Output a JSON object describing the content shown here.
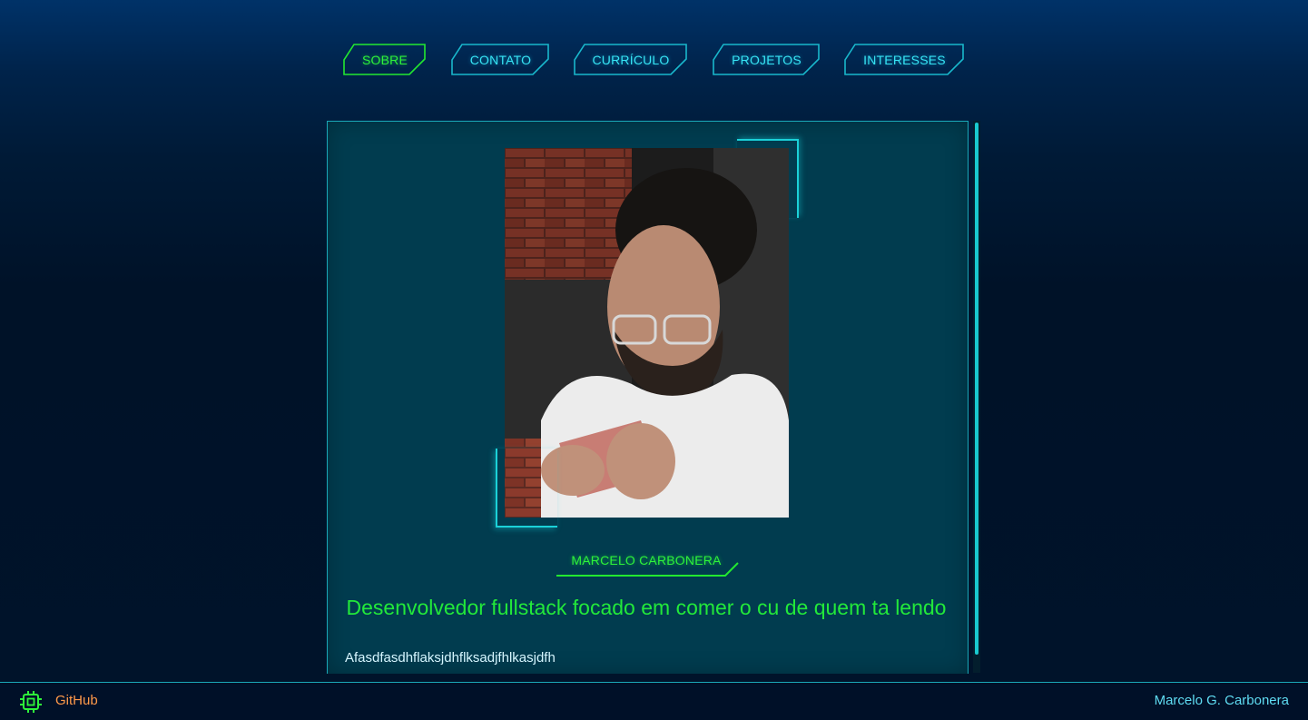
{
  "nav": {
    "tabs": [
      {
        "label": "SOBRE",
        "active": true
      },
      {
        "label": "CONTATO",
        "active": false
      },
      {
        "label": "CURRÍCULO",
        "active": false
      },
      {
        "label": "PROJETOS",
        "active": false
      },
      {
        "label": "INTERESSES",
        "active": false
      }
    ]
  },
  "profile": {
    "name": "MARCELO CARBONERA",
    "headline": "Desenvolvedor fullstack focado em comer o cu de quem ta lendo",
    "body": "Afasdfasdhflaksjdhflksadjfhlkasjdfh",
    "photo_icon": "profile-photo"
  },
  "footer": {
    "github_label": "GitHub",
    "github_icon": "chip-icon",
    "author": "Marcelo G. Carbonera"
  },
  "colors": {
    "active": "#2ef23a",
    "inactive": "#38e4f4",
    "panel": "#013c4f",
    "github": "#ff9a4a"
  }
}
